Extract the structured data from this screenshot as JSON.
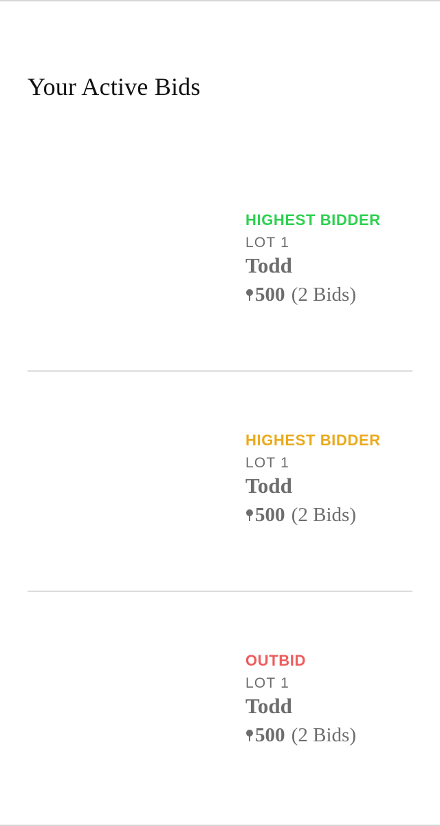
{
  "page": {
    "title": "Your Active Bids"
  },
  "bids": [
    {
      "status": "HIGHEST BIDDER",
      "status_color": "#2dd14f",
      "lot": "LOT 1",
      "name": "Todd",
      "amount": "500",
      "bid_count": "(2 Bids)"
    },
    {
      "status": "HIGHEST BIDDER",
      "status_color": "#eaaa1b",
      "lot": "LOT 1",
      "name": "Todd",
      "amount": "500",
      "bid_count": "(2 Bids)"
    },
    {
      "status": "OUTBID",
      "status_color": "#ee5c5c",
      "lot": "LOT 1",
      "name": "Todd",
      "amount": "500",
      "bid_count": "(2 Bids)"
    }
  ],
  "icons": {
    "currency": "paddle-currency-icon"
  },
  "colors": {
    "title_text": "#111111",
    "secondary_text": "#6d6d6d",
    "divider": "#dcdcdc"
  }
}
